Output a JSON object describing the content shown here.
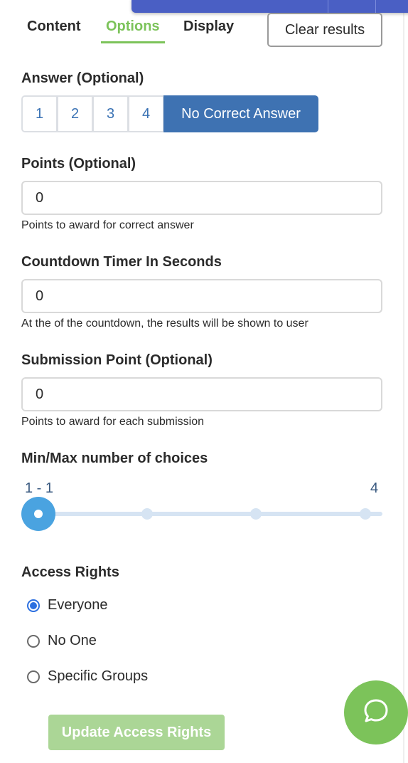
{
  "tabs": [
    {
      "label": "Content",
      "active": false
    },
    {
      "label": "Options",
      "active": true
    },
    {
      "label": "Display",
      "active": false
    }
  ],
  "clear_results_label": "Clear results",
  "answer": {
    "label": "Answer (Optional)",
    "options": [
      "1",
      "2",
      "3",
      "4",
      "No Correct Answer"
    ],
    "selected": "No Correct Answer"
  },
  "points": {
    "label": "Points (Optional)",
    "value": "0",
    "help": "Points to award for correct answer"
  },
  "countdown": {
    "label": "Countdown Timer In Seconds",
    "value": "0",
    "help": "At the of the countdown, the results will be shown to user"
  },
  "submission_point": {
    "label": "Submission Point (Optional)",
    "value": "0",
    "help": "Points to award for each submission"
  },
  "choices": {
    "label": "Min/Max number of choices",
    "range_text": "1 - 1",
    "max_text": "4",
    "min_value": 1,
    "max_value": 1,
    "scale_max": 4
  },
  "access_rights": {
    "label": "Access Rights",
    "options": [
      "Everyone",
      "No One",
      "Specific Groups"
    ],
    "selected": "Everyone",
    "update_label": "Update Access Rights"
  },
  "colors": {
    "accent_green": "#7cc35a",
    "selected_blue": "#3e72b2",
    "slider_blue": "#4aa3e0"
  },
  "icons": {
    "chat": "chat-bubble-icon"
  }
}
